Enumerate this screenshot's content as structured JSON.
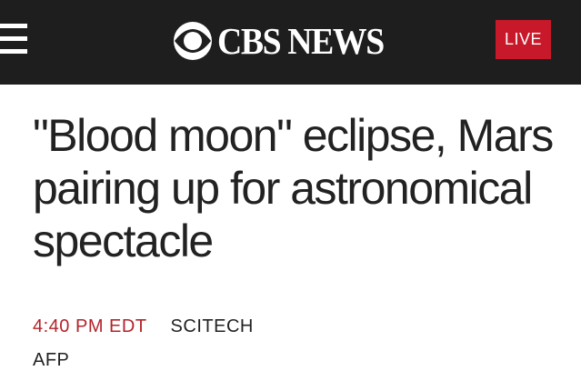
{
  "header": {
    "brand": "CBS NEWS",
    "brand_icon": "cbs-eye-logo",
    "menu_icon": "hamburger-menu-icon",
    "live_label": "LIVE",
    "background_color": "#1e1e1e",
    "live_color": "#c8192a"
  },
  "article": {
    "headline": "\"Blood moon\" eclipse, Mars pairing up for astronomical spectacle",
    "time": "4:40 PM EDT",
    "section": "SCITECH",
    "source": "AFP",
    "time_color": "#b3232a"
  }
}
